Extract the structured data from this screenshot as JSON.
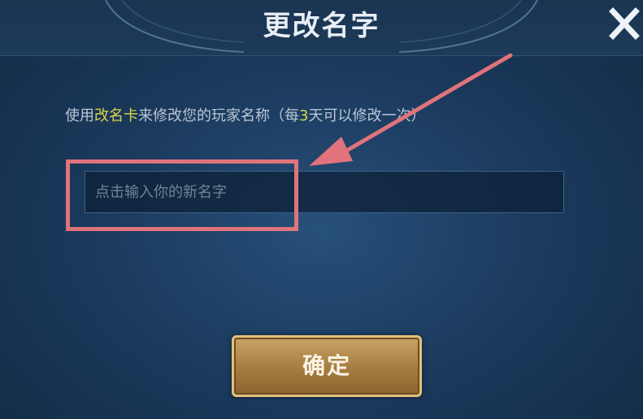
{
  "dialog": {
    "title": "更改名字",
    "close_icon": "close-icon",
    "description": {
      "prefix": "使用",
      "highlight_item": "改名卡",
      "middle": "来修改您的玩家名称（每",
      "highlight_days": "3",
      "suffix": "天可以修改一次）"
    },
    "name_input": {
      "placeholder": "点击输入你的新名字",
      "value": ""
    },
    "confirm_label": "确定"
  },
  "colors": {
    "highlight_text": "#d9d44a",
    "annotation": "#e0737b",
    "button_gold": "#a57c40",
    "background": "#1c3b5f"
  }
}
